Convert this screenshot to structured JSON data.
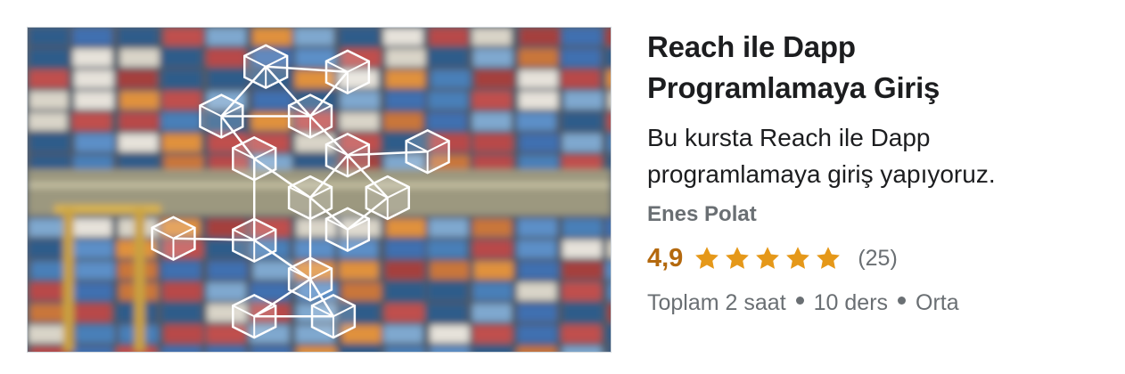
{
  "course": {
    "title_line1": "Reach ile Dapp",
    "title_line2": "Programlamaya Giriş",
    "headline_line1": "Bu kursta Reach ile Dapp",
    "headline_line2": "programlamaya giriş yapıyoruz.",
    "instructor": "Enes Polat",
    "rating": "4,9",
    "rating_stars": 5,
    "rating_count": "(25)",
    "meta": {
      "duration": "Toplam 2 saat",
      "lectures": "10 ders",
      "level": "Orta"
    }
  },
  "icons": {
    "star": "star-icon",
    "thumbnail": "blockchain-cubes-over-shipping-containers"
  },
  "colors": {
    "title": "#1c1d1f",
    "muted": "#6a6f73",
    "rating": "#b4690e",
    "star": "#e59819"
  }
}
